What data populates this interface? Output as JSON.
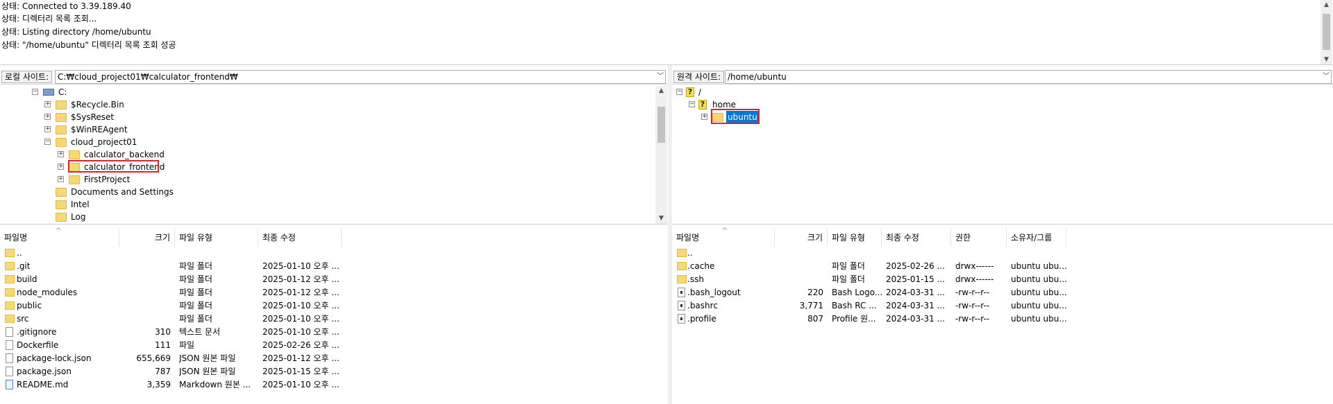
{
  "log": {
    "lines": [
      {
        "prefix": "상태:",
        "text": "Connected to 3.39.189.40"
      },
      {
        "prefix": "상태:",
        "text": "디렉터리 목록 조회..."
      },
      {
        "prefix": "상태:",
        "text": "Listing directory /home/ubuntu"
      },
      {
        "prefix": "상태:",
        "text": "\"/home/ubuntu\" 디렉터리 목록 조회 성공"
      }
    ]
  },
  "local": {
    "label": "로컬 사이트:",
    "path": "C:₩cloud_project01₩calculator_frontend₩",
    "tree": [
      {
        "label": "C:"
      },
      {
        "label": "$Recycle.Bin"
      },
      {
        "label": "$SysReset"
      },
      {
        "label": "$WinREAgent"
      },
      {
        "label": "cloud_project01"
      },
      {
        "label": "calculator_backend"
      },
      {
        "label": "calculator_frontend"
      },
      {
        "label": "FirstProject"
      },
      {
        "label": "Documents and Settings"
      },
      {
        "label": "Intel"
      },
      {
        "label": "Log"
      }
    ],
    "columns": [
      "파일명",
      "크기",
      "파일 유형",
      "최종 수정"
    ],
    "files": [
      {
        "name": "..",
        "size": "",
        "type": "",
        "modified": ""
      },
      {
        "name": ".git",
        "size": "",
        "type": "파일 폴더",
        "modified": "2025-01-10 오후 ..."
      },
      {
        "name": "build",
        "size": "",
        "type": "파일 폴더",
        "modified": "2025-01-12 오후 ..."
      },
      {
        "name": "node_modules",
        "size": "",
        "type": "파일 폴더",
        "modified": "2025-01-12 오후 ..."
      },
      {
        "name": "public",
        "size": "",
        "type": "파일 폴더",
        "modified": "2025-01-10 오후 ..."
      },
      {
        "name": "src",
        "size": "",
        "type": "파일 폴더",
        "modified": "2025-01-10 오후 ..."
      },
      {
        "name": ".gitignore",
        "size": "310",
        "type": "텍스트 문서",
        "modified": "2025-01-10 오후 ..."
      },
      {
        "name": "Dockerfile",
        "size": "111",
        "type": "파일",
        "modified": "2025-02-26 오후 ..."
      },
      {
        "name": "package-lock.json",
        "size": "655,669",
        "type": "JSON 원본 파일",
        "modified": "2025-01-12 오후 ..."
      },
      {
        "name": "package.json",
        "size": "787",
        "type": "JSON 원본 파일",
        "modified": "2025-01-15 오후 ..."
      },
      {
        "name": "README.md",
        "size": "3,359",
        "type": "Markdown 원본 ...",
        "modified": "2025-01-10 오후 ..."
      }
    ]
  },
  "remote": {
    "label": "원격 사이트:",
    "path": "/home/ubuntu",
    "tree": [
      {
        "label": "/"
      },
      {
        "label": "home"
      },
      {
        "label": "ubuntu"
      }
    ],
    "columns": [
      "파일명",
      "크기",
      "파일 유형",
      "최종 수정",
      "권한",
      "소유자/그룹"
    ],
    "files": [
      {
        "name": "..",
        "size": "",
        "type": "",
        "modified": "",
        "perm": "",
        "owner": ""
      },
      {
        "name": ".cache",
        "size": "",
        "type": "파일 폴더",
        "modified": "2025-02-26 ...",
        "perm": "drwx------",
        "owner": "ubuntu ubu..."
      },
      {
        "name": ".ssh",
        "size": "",
        "type": "파일 폴더",
        "modified": "2025-01-15 ...",
        "perm": "drwx------",
        "owner": "ubuntu ubu..."
      },
      {
        "name": ".bash_logout",
        "size": "220",
        "type": "Bash Logo...",
        "modified": "2024-03-31 ...",
        "perm": "-rw-r--r--",
        "owner": "ubuntu ubu..."
      },
      {
        "name": ".bashrc",
        "size": "3,771",
        "type": "Bash RC ...",
        "modified": "2024-03-31 ...",
        "perm": "-rw-r--r--",
        "owner": "ubuntu ubu..."
      },
      {
        "name": ".profile",
        "size": "807",
        "type": "Profile 원...",
        "modified": "2024-03-31 ...",
        "perm": "-rw-r--r--",
        "owner": "ubuntu ubu..."
      }
    ]
  }
}
